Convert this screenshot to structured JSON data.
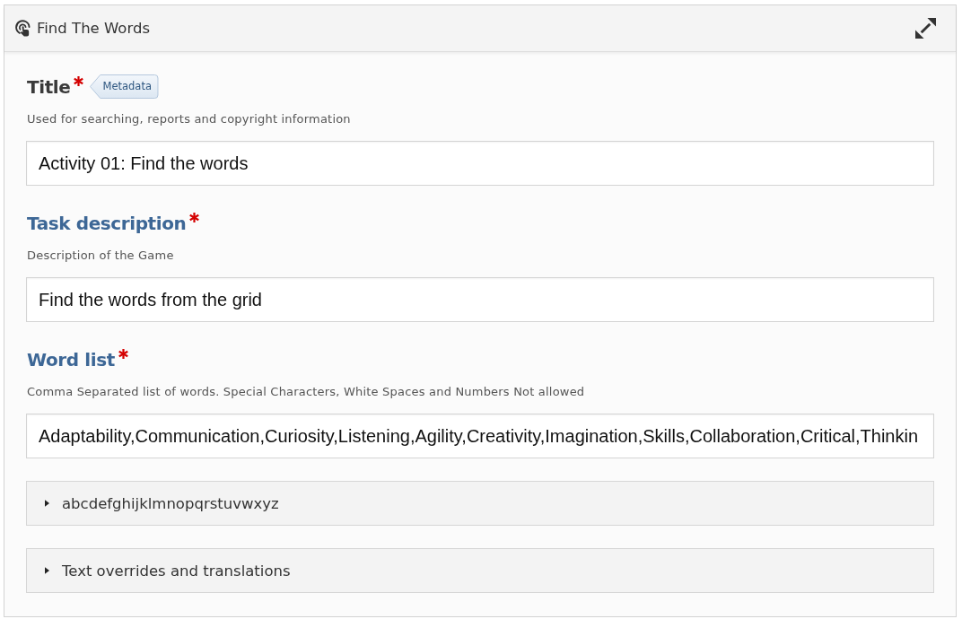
{
  "panel": {
    "title": "Find The Words"
  },
  "fields": [
    {
      "label": "Title",
      "required": true,
      "highlighted": false,
      "metadata_button": "Metadata",
      "description": "Used for searching, reports and copyright information",
      "value": "Activity 01: Find the words"
    },
    {
      "label": "Task description",
      "required": true,
      "highlighted": true,
      "description": "Description of the Game",
      "value": "Find the words from the grid"
    },
    {
      "label": "Word list",
      "required": true,
      "highlighted": true,
      "description": "Comma Separated list of words. Special Characters, White Spaces and Numbers Not allowed",
      "value": "Adaptability,Communication,Curiosity,Listening,Agility,Creativity,Imagination,Skills,Collaboration,Critical,Thinkin"
    }
  ],
  "groups": [
    {
      "label": "abcdefghijklmnopqrstuvwxyz",
      "expanded": false
    },
    {
      "label": "Text overrides and translations",
      "expanded": false
    }
  ]
}
